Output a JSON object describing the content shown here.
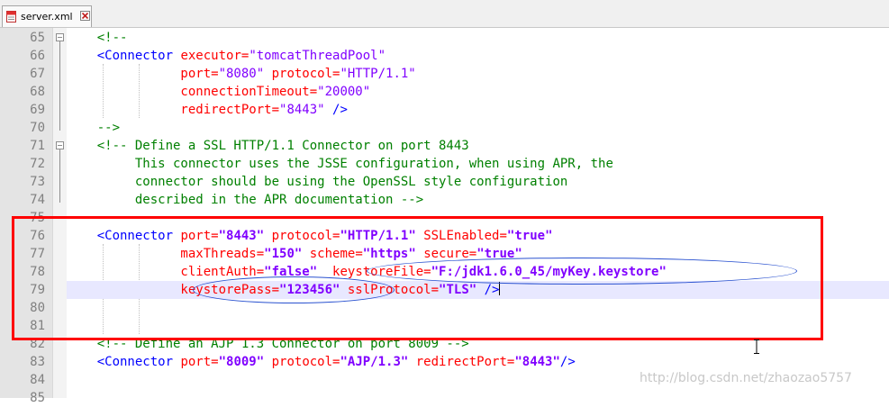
{
  "tab": {
    "label": "server.xml"
  },
  "colors": {
    "comment": "#008000",
    "tag": "#0000ff",
    "attribute": "#ff0000",
    "value": "#8000ff",
    "annotation_box": "#ff0000",
    "annotation_ellipse": "#2a52d0"
  },
  "lines": [
    {
      "num": "65",
      "parts": [
        {
          "c": "cm",
          "t": "    <!--"
        }
      ]
    },
    {
      "num": "66",
      "parts": [
        {
          "c": "tag",
          "t": "    <Connector"
        },
        {
          "c": "attr",
          "t": " executor="
        },
        {
          "c": "val",
          "t": "\"tomcatThreadPool\""
        }
      ]
    },
    {
      "num": "67",
      "parts": [
        {
          "c": "attr",
          "t": "               port="
        },
        {
          "c": "val",
          "t": "\"8080\""
        },
        {
          "c": "attr",
          "t": " protocol="
        },
        {
          "c": "val",
          "t": "\"HTTP/1.1\""
        }
      ]
    },
    {
      "num": "68",
      "parts": [
        {
          "c": "attr",
          "t": "               connectionTimeout="
        },
        {
          "c": "val",
          "t": "\"20000\""
        }
      ]
    },
    {
      "num": "69",
      "parts": [
        {
          "c": "attr",
          "t": "               redirectPort="
        },
        {
          "c": "val",
          "t": "\"8443\""
        },
        {
          "c": "tag",
          "t": " />"
        }
      ]
    },
    {
      "num": "70",
      "parts": [
        {
          "c": "cm",
          "t": "    -->"
        }
      ]
    },
    {
      "num": "71",
      "parts": [
        {
          "c": "cm",
          "t": "    <!-- Define a SSL HTTP/1.1 Connector on port 8443"
        }
      ]
    },
    {
      "num": "72",
      "parts": [
        {
          "c": "cm",
          "t": "         This connector uses the JSSE configuration, when using APR, the"
        }
      ]
    },
    {
      "num": "73",
      "parts": [
        {
          "c": "cm",
          "t": "         connector should be using the OpenSSL style configuration"
        }
      ]
    },
    {
      "num": "74",
      "parts": [
        {
          "c": "cm",
          "t": "         described in the APR documentation -->"
        }
      ]
    },
    {
      "num": "75",
      "parts": []
    },
    {
      "num": "76",
      "parts": [
        {
          "c": "tag",
          "t": "    <Connector"
        },
        {
          "c": "attr",
          "t": " port="
        },
        {
          "c": "valb",
          "t": "\"8443\""
        },
        {
          "c": "attr",
          "t": " protocol="
        },
        {
          "c": "valb",
          "t": "\"HTTP/1.1\""
        },
        {
          "c": "attr",
          "t": " SSLEnabled="
        },
        {
          "c": "valb",
          "t": "\"true\""
        }
      ]
    },
    {
      "num": "77",
      "parts": [
        {
          "c": "attr",
          "t": "               maxThreads="
        },
        {
          "c": "valb",
          "t": "\"150\""
        },
        {
          "c": "attr",
          "t": " scheme="
        },
        {
          "c": "valb",
          "t": "\"https\""
        },
        {
          "c": "attr",
          "t": " secure="
        },
        {
          "c": "valb",
          "t": "\"true\""
        }
      ]
    },
    {
      "num": "78",
      "parts": [
        {
          "c": "attr",
          "t": "               clientAuth="
        },
        {
          "c": "valb",
          "t": "\"false\""
        },
        {
          "c": "attr",
          "t": "  keystoreFile="
        },
        {
          "c": "valb",
          "t": "\"F:/jdk1.6.0_45/myKey.keystore\""
        }
      ]
    },
    {
      "num": "79",
      "parts": [
        {
          "c": "attr",
          "t": "               keystorePass="
        },
        {
          "c": "valb",
          "t": "\"123456\""
        },
        {
          "c": "attr",
          "t": " sslProtocol="
        },
        {
          "c": "valb",
          "t": "\"TLS\""
        },
        {
          "c": "tag",
          "t": " />"
        }
      ]
    },
    {
      "num": "80",
      "parts": []
    },
    {
      "num": "81",
      "parts": []
    },
    {
      "num": "82",
      "parts": [
        {
          "c": "cm",
          "t": "    <!-- Define an AJP 1.3 Connector on port 8009 -->"
        }
      ]
    },
    {
      "num": "83",
      "parts": [
        {
          "c": "tag",
          "t": "    <Connector"
        },
        {
          "c": "attr",
          "t": " port="
        },
        {
          "c": "valb",
          "t": "\"8009\""
        },
        {
          "c": "attr",
          "t": " protocol="
        },
        {
          "c": "valb",
          "t": "\"AJP/1.3\""
        },
        {
          "c": "attr",
          "t": " redirectPort="
        },
        {
          "c": "valb",
          "t": "\"8443\""
        },
        {
          "c": "tag",
          "t": "/>"
        }
      ]
    },
    {
      "num": "84",
      "parts": []
    },
    {
      "num": "85",
      "parts": []
    }
  ],
  "current_line_num": "79",
  "watermark": "http://blog.csdn.net/zhaozao5757"
}
